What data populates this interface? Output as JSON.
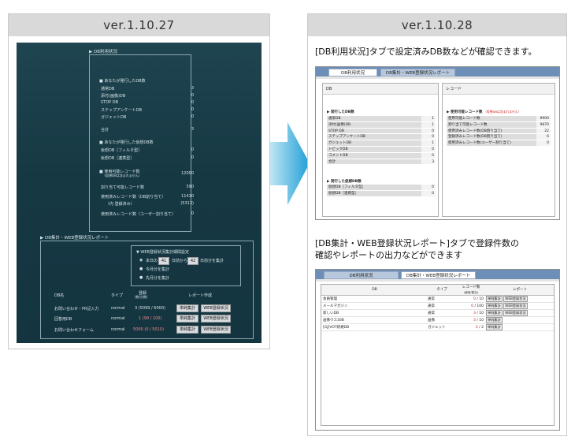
{
  "left": {
    "version": "ver.1.10.27",
    "db_usage_title": "▶ DB利用状況",
    "own_db_title": "■ あなたが発行したDB数",
    "own_db_rows": [
      {
        "label": "通常DB",
        "value": "3"
      },
      {
        "label": "添付(画像)DB",
        "value": "0"
      },
      {
        "label": "STOP DB",
        "value": "0"
      },
      {
        "label": "ステップアンケートDB",
        "value": "0"
      },
      {
        "label": "ガジェットDB",
        "value": "0"
      }
    ],
    "own_total_label": "合計",
    "own_total_value": "3",
    "virtual_title": "■ あなたが発行した仮想DB数",
    "virtual_rows": [
      {
        "label": "仮想DB［フィルタ型］",
        "value": "0"
      },
      {
        "label": "仮想DB［連携型］",
        "value": "0"
      }
    ],
    "records_title": "■ 使用可能レコード数",
    "records_sub": "（仮想DBは含まれません）",
    "records_value": "12000",
    "assigned_label": "割り当て可能レコード数",
    "assigned_value": "590",
    "used_label": "使用済みレコード数（DB割り当て）",
    "used_value": "11410",
    "used_sub_label": "（内 登録済み）",
    "used_sub_value": "(5313)",
    "user_assigned_label": "使用済みレコード数（ユーザー割り当て）",
    "user_assigned_value": "0",
    "report_title": "▶ DB集計・WEB登録状況レポート",
    "period_title": "▼ WEB登録状況集計期間設定",
    "period_from_label": "本日の",
    "period_from_value": "41",
    "period_mid": "日前から",
    "period_to_value": "42",
    "period_end": "日前分を集計",
    "period_opt2": "今月分を集計",
    "period_opt3": "先月分を集計",
    "col_db": "DB名",
    "col_type": "タイプ",
    "col_count": "登録",
    "col_count_sub": "(数/分数)",
    "col_report": "レポート作成",
    "rows": [
      {
        "name": "お問い合わせ・PR記入力",
        "type": "normal",
        "count": "3 (5099 / 6000)",
        "btn1": "単純集計",
        "btn2": "WEB登録状況"
      },
      {
        "name": "回答用DB",
        "type": "normal",
        "count": "1 (99 / 100)",
        "btn1": "単純集計",
        "btn2": "WEB登録状況"
      },
      {
        "name": "お問い合わせフォーム",
        "type": "normal",
        "count": "5000 (0 / 5010)",
        "btn1": "単純集計",
        "btn2": "WEB登録状況"
      }
    ]
  },
  "right": {
    "version": "ver.1.10.28",
    "caption1": "[DB利用状況]タブで設定済みDB数などが確認できます。",
    "caption2a": "[DB集計・WEB登録状況レポート]タブで登録件数の",
    "caption2b": "確認やレポートの出力などができます",
    "tab_usage": "DB利用状況",
    "tab_report": "DB集計・WEB登録状況レポート",
    "db_header": "DB",
    "record_header": "レコード",
    "own_group": "▶ 発行したDB数",
    "own_rows": [
      {
        "label": "通常DB",
        "value": "1"
      },
      {
        "label": "添付(画像)DB",
        "value": "1"
      },
      {
        "label": "STOP DB",
        "value": "0"
      },
      {
        "label": "ステップアンケートDB",
        "value": "0"
      },
      {
        "label": "ガジェットDB",
        "value": "1"
      },
      {
        "label": "トピックDB",
        "value": "0"
      },
      {
        "label": "コメントDB",
        "value": "0"
      },
      {
        "label": "合計",
        "value": "3"
      }
    ],
    "virtual_group": "▶ 発行した仮想DB数",
    "virtual_rows": [
      {
        "label": "仮想DB［フィルタ型］",
        "value": "0"
      },
      {
        "label": "仮想DB［連携型］",
        "value": "0"
      }
    ],
    "records_group": "▶ 使用可能レコード数",
    "records_note": "（仮想DBは含まれません）",
    "record_rows": [
      {
        "label": "使用可能レコード数",
        "value": "9900"
      },
      {
        "label": "割り当て可能レコード数",
        "value": "9870"
      },
      {
        "label": "使用済みレコード数(DB割り当て)",
        "value": "22"
      },
      {
        "label": "登録済みレコード数(DB割り当て)",
        "value": "6"
      },
      {
        "label": "使用済みレコード数(ユーザー割り当て)",
        "value": "0"
      }
    ],
    "rep_col_db": "DB",
    "rep_col_type": "タイプ",
    "rep_col_count": "レコード数",
    "rep_col_count_sub": "(使用/割当)",
    "rep_col_report": "レポート",
    "rep_rows": [
      {
        "name": "会員管理",
        "type": "通常",
        "used": "0",
        "total": "10",
        "btn1": "単純集計",
        "btn2": "WEB登録状況"
      },
      {
        "name": "メールマガジン",
        "type": "通常",
        "used": "0",
        "total": "100",
        "btn1": "単純集計",
        "btn2": "WEB登録状況"
      },
      {
        "name": "新しいDB",
        "type": "通常",
        "used": "3",
        "total": "10",
        "btn1": "単純集計",
        "btn2": "WEB登録状況"
      },
      {
        "name": "画像ウス30B",
        "type": "画像",
        "used": "3",
        "total": "10",
        "btn1": "単純集計",
        "btn2": ""
      },
      {
        "name": "[GJ]VOT新規DB",
        "type": "ガジェット",
        "used": "2",
        "total": "2",
        "btn1": "単純集計",
        "btn2": ""
      }
    ]
  },
  "colors": {
    "accent": "#2aa6d8",
    "dark_bg": "#163843",
    "tab_bar": "#6c8eb7",
    "red_value": "#d02020"
  }
}
